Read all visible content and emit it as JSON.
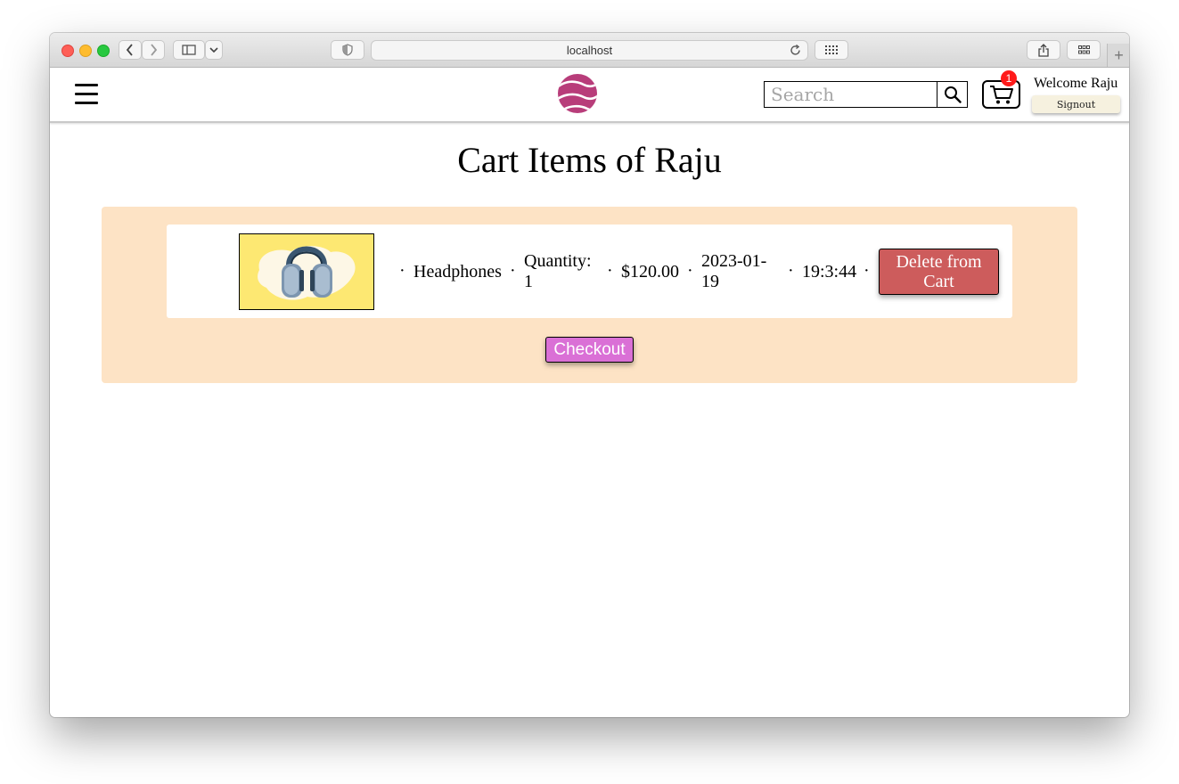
{
  "browser": {
    "url": "localhost"
  },
  "header": {
    "search_placeholder": "Search",
    "cart_count": "1",
    "welcome_text": "Welcome Raju",
    "signout_label": "Signout"
  },
  "main": {
    "title": "Cart Items of Raju",
    "cart_items": [
      {
        "name": "Headphones",
        "quantity_label": "Quantity:",
        "quantity": "1",
        "price": "$120.00",
        "date_line1": "2023-01-",
        "date_line2": "19",
        "time": "19:3:44",
        "delete_label_line1": "Delete from",
        "delete_label_line2": "Cart"
      }
    ],
    "separator": "·",
    "checkout_label": "Checkout"
  },
  "colors": {
    "panel_background": "#fde3c5",
    "delete_button": "#cd5c5c",
    "checkout_button": "#da70d6",
    "cart_badge": "#ff1a1a",
    "signout_background": "#f6f1df",
    "logo": "#b83d7a",
    "product_image_background": "#fde872"
  },
  "icons": [
    "menu-icon",
    "site-logo",
    "search-icon",
    "shopping-cart-icon",
    "back-icon",
    "forward-icon",
    "sidebar-icon",
    "shield-icon",
    "reload-icon",
    "grid-icon",
    "share-icon",
    "tab-overview-icon",
    "new-tab-icon"
  ]
}
